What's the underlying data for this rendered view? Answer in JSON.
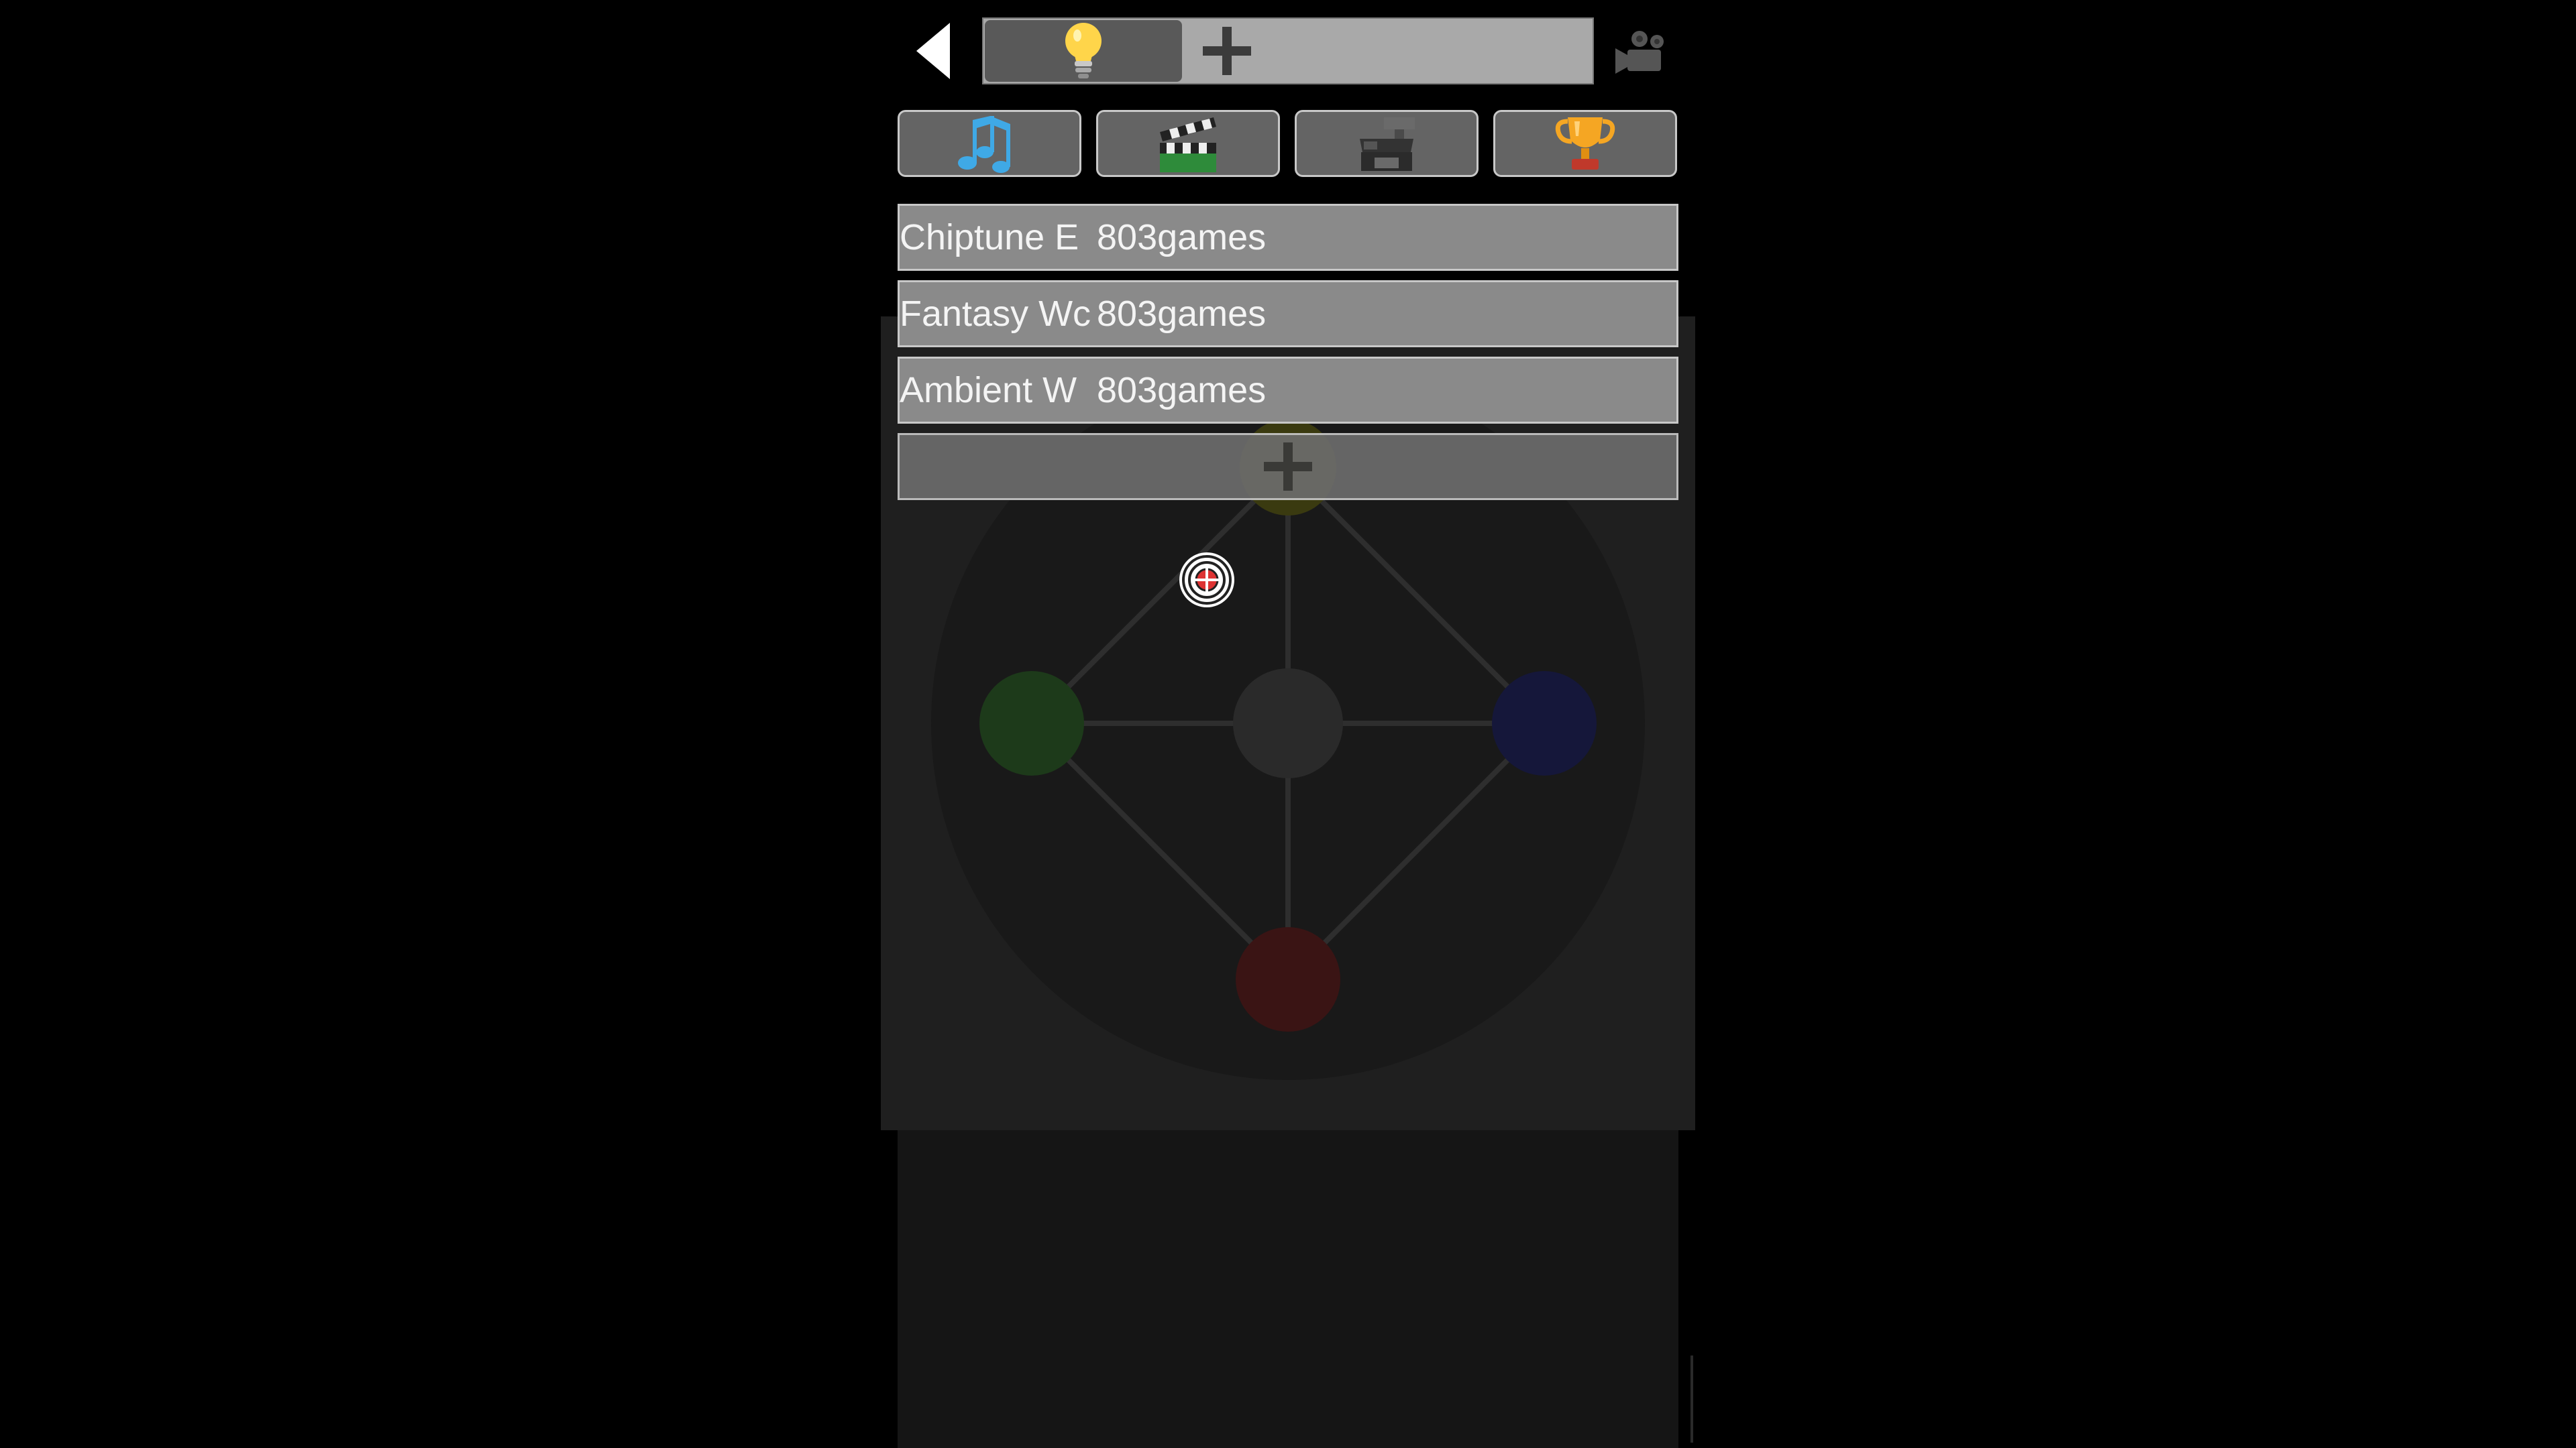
{
  "header": {
    "back_icon": "back-arrow-icon",
    "active_tab_icon": "lightbulb-icon",
    "add_tab_icon": "plus-icon",
    "camera_icon": "video-camera-icon"
  },
  "categories": [
    {
      "icon": "music-notes-icon"
    },
    {
      "icon": "clapperboard-icon"
    },
    {
      "icon": "cash-register-icon"
    },
    {
      "icon": "trophy-icon"
    }
  ],
  "tracks": [
    {
      "name": "Chiptune E",
      "author": "803games"
    },
    {
      "name": "Fantasy Wc",
      "author": "803games"
    },
    {
      "name": "Ambient W",
      "author": "803games"
    }
  ],
  "add_row_icon": "plus-icon",
  "colors": {
    "background": "#000000",
    "panel": "#1f1f1f",
    "tab_strip": "#a9a9a9",
    "active_tab": "#595959",
    "track_row": "#8a8a8a",
    "node_green": "#1d3a1a",
    "node_blue": "#15173a",
    "node_red": "#3a1414",
    "node_olive": "#3a3a10",
    "node_center": "#2a2a2a"
  }
}
